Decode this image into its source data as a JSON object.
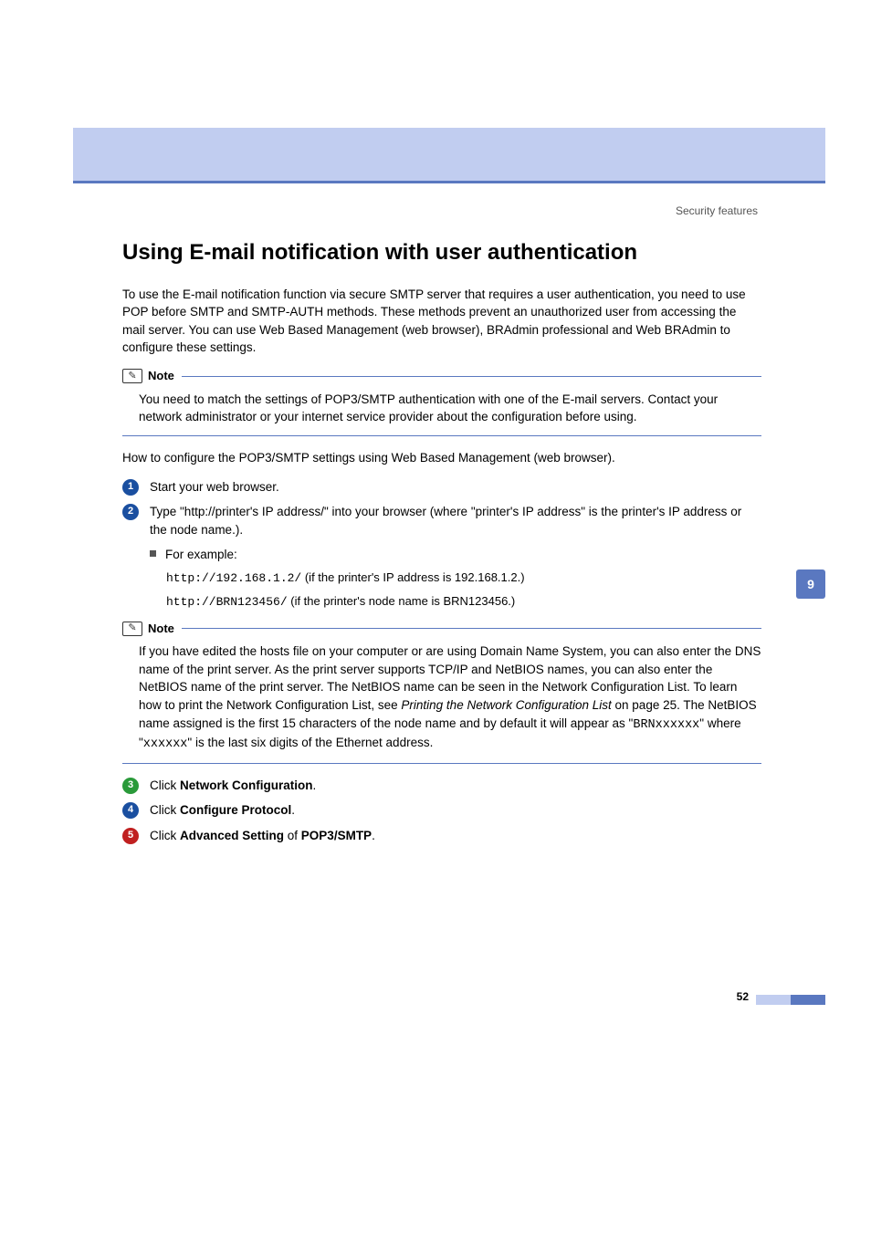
{
  "header": {
    "label": "Security features"
  },
  "sectionTab": "9",
  "title": "Using E-mail notification with user authentication",
  "intro": "To use the E-mail notification function via secure SMTP server that requires a user authentication, you need to use POP before SMTP and SMTP-AUTH methods. These methods prevent an unauthorized user from accessing the mail server. You can use Web Based Management (web browser), BRAdmin professional and Web BRAdmin to configure these settings.",
  "note1": {
    "label": "Note",
    "body": "You need to match the settings of POP3/SMTP authentication with one of the E-mail servers. Contact your network administrator or your internet service provider about the configuration before using."
  },
  "howto": "How to configure the POP3/SMTP settings using Web Based Management (web browser).",
  "steps": {
    "s1": "Start your web browser.",
    "s2": "Type \"http://printer's IP address/\" into your browser (where \"printer's IP address\" is the printer's IP address or the node name.).",
    "s2_example_label": "For example:",
    "s2_ex1_code": "http://192.168.1.2/",
    "s2_ex1_tail": " (if the printer's IP address is 192.168.1.2.)",
    "s2_ex2_code": "http://BRN123456/",
    "s2_ex2_tail": " (if the printer's node name is BRN123456.)",
    "s3_pre": "Click ",
    "s3_bold": "Network Configuration",
    "s3_post": ".",
    "s4_pre": "Click ",
    "s4_bold": "Configure Protocol",
    "s4_post": ".",
    "s5_pre": "Click ",
    "s5_bold1": "Advanced Setting",
    "s5_mid": " of ",
    "s5_bold2": "POP3/SMTP",
    "s5_post": "."
  },
  "note2": {
    "label": "Note",
    "body_pre": "If you have edited the hosts file on your computer or are using Domain Name System, you can also enter the DNS name of the print server. As the print server supports TCP/IP and NetBIOS names, you can also enter the NetBIOS name of the print server. The NetBIOS name can be seen in the Network Configuration List. To learn how to print the Network Configuration List, see ",
    "body_italic": "Printing the Network Configuration List",
    "body_mid1": " on page 25. The NetBIOS name assigned is the first 15 characters of the node name and by default it will appear as \"",
    "body_code1": "BRNxxxxxx",
    "body_mid2": "\" where \"",
    "body_code2": "xxxxxx",
    "body_post": "\" is the last six digits of the Ethernet address."
  },
  "pageNumber": "52"
}
